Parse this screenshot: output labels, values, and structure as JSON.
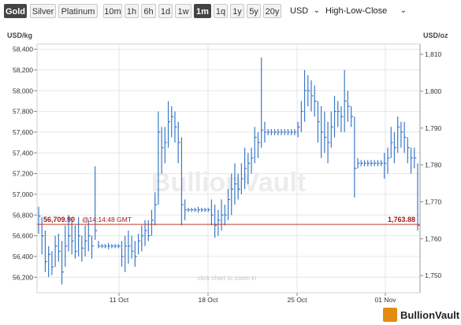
{
  "toolbar": {
    "metals": [
      {
        "label": "Gold",
        "active": true
      },
      {
        "label": "Silver",
        "active": false
      },
      {
        "label": "Platinum",
        "active": false
      }
    ],
    "ranges": [
      {
        "label": "10m",
        "active": false
      },
      {
        "label": "1h",
        "active": false
      },
      {
        "label": "6h",
        "active": false
      },
      {
        "label": "1d",
        "active": false
      },
      {
        "label": "1w",
        "active": false
      },
      {
        "label": "1m",
        "active": true
      },
      {
        "label": "1q",
        "active": false
      },
      {
        "label": "1y",
        "active": false
      },
      {
        "label": "5y",
        "active": false
      },
      {
        "label": "20y",
        "active": false
      }
    ],
    "currency": "USD",
    "chart_style": "High-Low-Close"
  },
  "left_unit": "USD/kg",
  "right_unit": "USD/oz",
  "watermark": "BullionVault",
  "zoom_hint": "click chart to zoom in",
  "current_price_left": "56,709.90",
  "current_time": "@14:14:48 GMT",
  "current_price_right": "1,763.88",
  "logo_text": "BullionVault",
  "colors": {
    "series": "#3a78c8",
    "current_line": "#c0392b",
    "grid": "#e6e6e6",
    "accent": "#e58a12"
  },
  "chart_data": {
    "type": "hlc",
    "left_axis": {
      "label": "USD/kg",
      "ylim": [
        56050,
        58450
      ],
      "ticks": [
        56200,
        56400,
        56600,
        56800,
        57000,
        57200,
        57400,
        57600,
        57800,
        58000,
        58200,
        58400
      ],
      "tick_labels": [
        "56,200",
        "56,400",
        "56,600",
        "56,800",
        "57,000",
        "57,200",
        "57,400",
        "57,600",
        "57,800",
        "58,000",
        "58,200",
        "58,400"
      ]
    },
    "right_axis": {
      "label": "USD/oz",
      "ticks": [
        1750,
        1760,
        1770,
        1780,
        1790,
        1800,
        1810
      ],
      "tick_labels": [
        "1,750",
        "1,760",
        "1,770",
        "1,780",
        "1,790",
        "1,800",
        "1,810"
      ]
    },
    "x_ticks": [
      "11 Oct",
      "18 Oct",
      "25 Oct",
      "01 Nov"
    ],
    "grid": true,
    "current_value_kg": 56709.9,
    "current_value_oz": 1763.88,
    "bars": [
      {
        "h": 56880,
        "l": 56620,
        "c": 56790
      },
      {
        "h": 56780,
        "l": 56420,
        "c": 56600
      },
      {
        "h": 56650,
        "l": 56250,
        "c": 56350
      },
      {
        "h": 56500,
        "l": 56200,
        "c": 56420
      },
      {
        "h": 56450,
        "l": 56220,
        "c": 56300
      },
      {
        "h": 56600,
        "l": 56300,
        "c": 56500
      },
      {
        "h": 56620,
        "l": 56350,
        "c": 56450
      },
      {
        "h": 56550,
        "l": 56130,
        "c": 56250
      },
      {
        "h": 56700,
        "l": 56300,
        "c": 56500
      },
      {
        "h": 56800,
        "l": 56450,
        "c": 56600
      },
      {
        "h": 56780,
        "l": 56420,
        "c": 56550
      },
      {
        "h": 56700,
        "l": 56380,
        "c": 56450
      },
      {
        "h": 56780,
        "l": 56400,
        "c": 56600
      },
      {
        "h": 56600,
        "l": 56350,
        "c": 56480
      },
      {
        "h": 56700,
        "l": 56400,
        "c": 56550
      },
      {
        "h": 56750,
        "l": 56450,
        "c": 56600
      },
      {
        "h": 56600,
        "l": 56380,
        "c": 56500
      },
      {
        "h": 57270,
        "l": 56560,
        "c": 56650
      },
      {
        "h": 56550,
        "l": 56480,
        "c": 56500
      },
      {
        "h": 56520,
        "l": 56480,
        "c": 56500
      },
      {
        "h": 56520,
        "l": 56480,
        "c": 56500
      },
      {
        "h": 56530,
        "l": 56470,
        "c": 56500
      },
      {
        "h": 56520,
        "l": 56480,
        "c": 56500
      },
      {
        "h": 56520,
        "l": 56480,
        "c": 56500
      },
      {
        "h": 56520,
        "l": 56480,
        "c": 56500
      },
      {
        "h": 56550,
        "l": 56300,
        "c": 56400
      },
      {
        "h": 56600,
        "l": 56250,
        "c": 56500
      },
      {
        "h": 56650,
        "l": 56330,
        "c": 56500
      },
      {
        "h": 56600,
        "l": 56380,
        "c": 56450
      },
      {
        "h": 56550,
        "l": 56300,
        "c": 56400
      },
      {
        "h": 56620,
        "l": 56420,
        "c": 56550
      },
      {
        "h": 56700,
        "l": 56450,
        "c": 56600
      },
      {
        "h": 56750,
        "l": 56500,
        "c": 56650
      },
      {
        "h": 56750,
        "l": 56550,
        "c": 56600
      },
      {
        "h": 56850,
        "l": 56600,
        "c": 56750
      },
      {
        "h": 57020,
        "l": 56700,
        "c": 56900
      },
      {
        "h": 57800,
        "l": 56900,
        "c": 57600
      },
      {
        "h": 57650,
        "l": 57200,
        "c": 57450
      },
      {
        "h": 57650,
        "l": 57300,
        "c": 57500
      },
      {
        "h": 57900,
        "l": 57450,
        "c": 57700
      },
      {
        "h": 57850,
        "l": 57550,
        "c": 57750
      },
      {
        "h": 57800,
        "l": 57500,
        "c": 57650
      },
      {
        "h": 57700,
        "l": 57300,
        "c": 57500
      },
      {
        "h": 57550,
        "l": 56700,
        "c": 56900
      },
      {
        "h": 56950,
        "l": 56750,
        "c": 56850
      },
      {
        "h": 56870,
        "l": 56830,
        "c": 56850
      },
      {
        "h": 56870,
        "l": 56830,
        "c": 56850
      },
      {
        "h": 56870,
        "l": 56830,
        "c": 56850
      },
      {
        "h": 56880,
        "l": 56820,
        "c": 56850
      },
      {
        "h": 56870,
        "l": 56830,
        "c": 56850
      },
      {
        "h": 56870,
        "l": 56830,
        "c": 56850
      },
      {
        "h": 56870,
        "l": 56830,
        "c": 56850
      },
      {
        "h": 56950,
        "l": 56700,
        "c": 56800
      },
      {
        "h": 56900,
        "l": 56580,
        "c": 56700
      },
      {
        "h": 56850,
        "l": 56600,
        "c": 56750
      },
      {
        "h": 56950,
        "l": 56650,
        "c": 56800
      },
      {
        "h": 56900,
        "l": 56700,
        "c": 56800
      },
      {
        "h": 57050,
        "l": 56750,
        "c": 56950
      },
      {
        "h": 57200,
        "l": 56800,
        "c": 57050
      },
      {
        "h": 57300,
        "l": 56900,
        "c": 57100
      },
      {
        "h": 57200,
        "l": 56950,
        "c": 57050
      },
      {
        "h": 57300,
        "l": 57000,
        "c": 57150
      },
      {
        "h": 57450,
        "l": 57050,
        "c": 57250
      },
      {
        "h": 57400,
        "l": 57100,
        "c": 57300
      },
      {
        "h": 57450,
        "l": 57200,
        "c": 57350
      },
      {
        "h": 57650,
        "l": 57300,
        "c": 57550
      },
      {
        "h": 57600,
        "l": 57350,
        "c": 57500
      },
      {
        "h": 58320,
        "l": 57450,
        "c": 57620
      },
      {
        "h": 57700,
        "l": 57500,
        "c": 57600
      },
      {
        "h": 57630,
        "l": 57570,
        "c": 57600
      },
      {
        "h": 57630,
        "l": 57570,
        "c": 57600
      },
      {
        "h": 57630,
        "l": 57570,
        "c": 57600
      },
      {
        "h": 57630,
        "l": 57570,
        "c": 57600
      },
      {
        "h": 57630,
        "l": 57570,
        "c": 57600
      },
      {
        "h": 57630,
        "l": 57570,
        "c": 57600
      },
      {
        "h": 57630,
        "l": 57570,
        "c": 57600
      },
      {
        "h": 57630,
        "l": 57570,
        "c": 57600
      },
      {
        "h": 57630,
        "l": 57570,
        "c": 57600
      },
      {
        "h": 57700,
        "l": 57550,
        "c": 57650
      },
      {
        "h": 57900,
        "l": 57600,
        "c": 57800
      },
      {
        "h": 58200,
        "l": 57700,
        "c": 58000
      },
      {
        "h": 58150,
        "l": 57850,
        "c": 58000
      },
      {
        "h": 58100,
        "l": 57800,
        "c": 57950
      },
      {
        "h": 58050,
        "l": 57750,
        "c": 57900
      },
      {
        "h": 57900,
        "l": 57500,
        "c": 57700
      },
      {
        "h": 57850,
        "l": 57350,
        "c": 57600
      },
      {
        "h": 57800,
        "l": 57400,
        "c": 57550
      },
      {
        "h": 57700,
        "l": 57300,
        "c": 57500
      },
      {
        "h": 57800,
        "l": 57450,
        "c": 57650
      },
      {
        "h": 57950,
        "l": 57550,
        "c": 57800
      },
      {
        "h": 57900,
        "l": 57650,
        "c": 57800
      },
      {
        "h": 57850,
        "l": 57600,
        "c": 57750
      },
      {
        "h": 58200,
        "l": 57600,
        "c": 57900
      },
      {
        "h": 58000,
        "l": 57700,
        "c": 57850
      },
      {
        "h": 57850,
        "l": 57650,
        "c": 57750
      },
      {
        "h": 57750,
        "l": 56970,
        "c": 57250
      },
      {
        "h": 57350,
        "l": 57250,
        "c": 57300
      },
      {
        "h": 57330,
        "l": 57270,
        "c": 57300
      },
      {
        "h": 57330,
        "l": 57270,
        "c": 57300
      },
      {
        "h": 57330,
        "l": 57270,
        "c": 57300
      },
      {
        "h": 57330,
        "l": 57270,
        "c": 57300
      },
      {
        "h": 57330,
        "l": 57270,
        "c": 57300
      },
      {
        "h": 57330,
        "l": 57270,
        "c": 57300
      },
      {
        "h": 57330,
        "l": 57270,
        "c": 57300
      },
      {
        "h": 57400,
        "l": 57150,
        "c": 57300
      },
      {
        "h": 57450,
        "l": 57200,
        "c": 57350
      },
      {
        "h": 57650,
        "l": 57350,
        "c": 57500
      },
      {
        "h": 57600,
        "l": 57300,
        "c": 57450
      },
      {
        "h": 57750,
        "l": 57400,
        "c": 57650
      },
      {
        "h": 57700,
        "l": 57450,
        "c": 57600
      },
      {
        "h": 57700,
        "l": 57400,
        "c": 57550
      },
      {
        "h": 57550,
        "l": 57300,
        "c": 57450
      },
      {
        "h": 57450,
        "l": 57200,
        "c": 57350
      },
      {
        "h": 57450,
        "l": 57250,
        "c": 57350
      },
      {
        "h": 57300,
        "l": 56650,
        "c": 56700
      }
    ]
  }
}
